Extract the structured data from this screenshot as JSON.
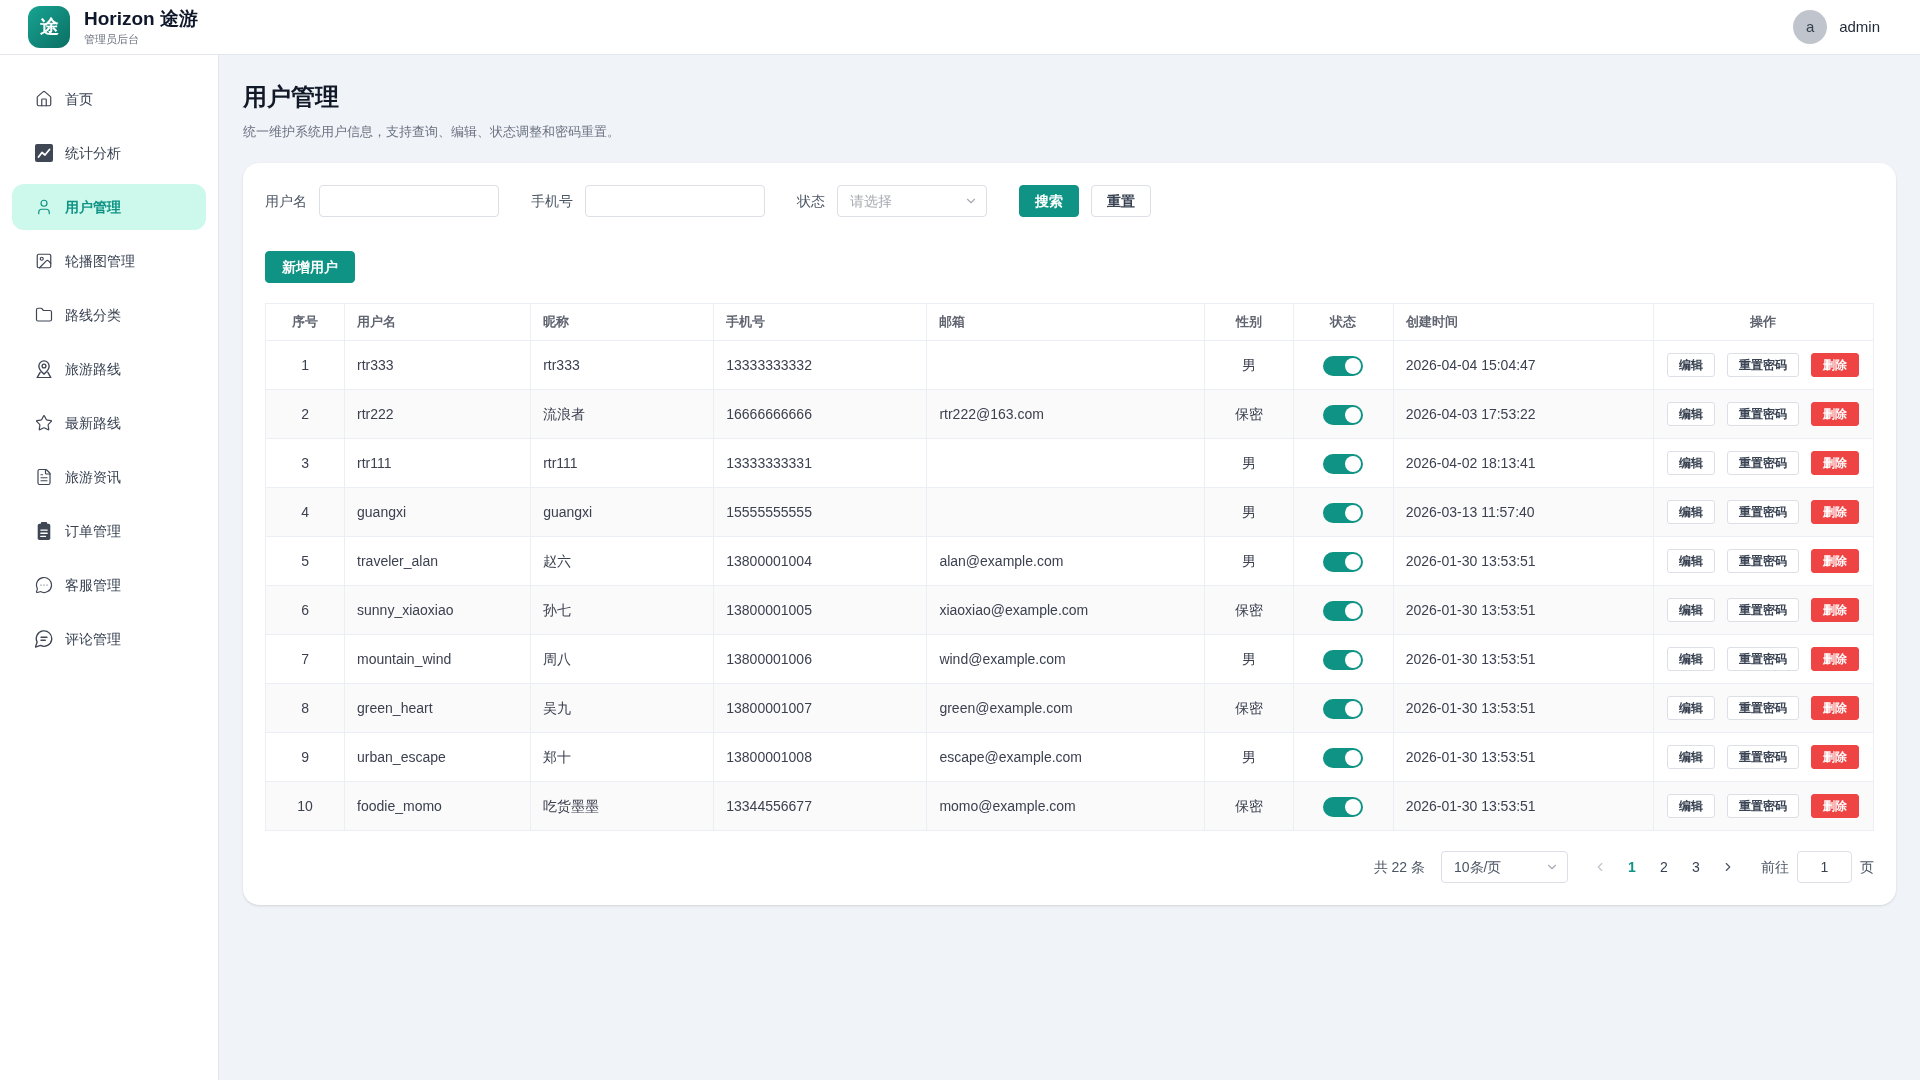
{
  "app": {
    "logo_text": "途",
    "title": "Horizon 途游",
    "subtitle": "管理员后台"
  },
  "user": {
    "avatar_letter": "a",
    "name": "admin"
  },
  "sidebar": {
    "items": [
      {
        "label": "首页",
        "selected": false
      },
      {
        "label": "统计分析",
        "selected": false
      },
      {
        "label": "用户管理",
        "selected": true
      },
      {
        "label": "轮播图管理",
        "selected": false
      },
      {
        "label": "路线分类",
        "selected": false
      },
      {
        "label": "旅游路线",
        "selected": false
      },
      {
        "label": "最新路线",
        "selected": false
      },
      {
        "label": "旅游资讯",
        "selected": false
      },
      {
        "label": "订单管理",
        "selected": false
      },
      {
        "label": "客服管理",
        "selected": false
      },
      {
        "label": "评论管理",
        "selected": false
      }
    ]
  },
  "page": {
    "title": "用户管理",
    "description": "统一维护系统用户信息，支持查询、编辑、状态调整和密码重置。"
  },
  "filters": [
    {
      "label": "用户名",
      "kind": "input"
    },
    {
      "label": "手机号",
      "kind": "input"
    },
    {
      "label": "状态",
      "kind": "select",
      "placeholder": "请选择"
    }
  ],
  "filter_buttons": [
    {
      "label": "搜索",
      "kind": "primary"
    },
    {
      "label": "重置",
      "kind": "default"
    }
  ],
  "add_button": {
    "label": "新增用户",
    "kind": "primary"
  },
  "table": {
    "columns": [
      "序号",
      "用户名",
      "昵称",
      "手机号",
      "邮箱",
      "性别",
      "状态",
      "创建时间",
      "操作"
    ],
    "rows": [
      {
        "index": "1",
        "username": "rtr333",
        "nickname": "rtr333",
        "phone": "13333333332",
        "gender": "男",
        "enabled": true,
        "created_at": "2026-04-04 15:04:47",
        "actions": [
          {
            "label": "编辑",
            "kind": "plain"
          },
          {
            "label": "重置密码",
            "kind": "plain"
          },
          {
            "label": "删除",
            "kind": "danger"
          }
        ]
      },
      {
        "index": "2",
        "username": "rtr222",
        "nickname": "流浪者",
        "phone": "16666666666",
        "email": "rtr222@163.com",
        "gender": "保密",
        "enabled": true,
        "created_at": "2026-04-03 17:53:22",
        "actions": [
          {
            "label": "编辑",
            "kind": "plain"
          },
          {
            "label": "重置密码",
            "kind": "plain"
          },
          {
            "label": "删除",
            "kind": "danger"
          }
        ]
      },
      {
        "index": "3",
        "username": "rtr111",
        "nickname": "rtr111",
        "phone": "13333333331",
        "gender": "男",
        "enabled": true,
        "created_at": "2026-04-02 18:13:41",
        "actions": [
          {
            "label": "编辑",
            "kind": "plain"
          },
          {
            "label": "重置密码",
            "kind": "plain"
          },
          {
            "label": "删除",
            "kind": "danger"
          }
        ]
      },
      {
        "index": "4",
        "username": "guangxi",
        "nickname": "guangxi",
        "phone": "15555555555",
        "gender": "男",
        "enabled": true,
        "created_at": "2026-03-13 11:57:40",
        "actions": [
          {
            "label": "编辑",
            "kind": "plain"
          },
          {
            "label": "重置密码",
            "kind": "plain"
          },
          {
            "label": "删除",
            "kind": "danger"
          }
        ]
      },
      {
        "index": "5",
        "username": "traveler_alan",
        "nickname": "赵六",
        "phone": "13800001004",
        "email": "alan@example.com",
        "gender": "男",
        "enabled": true,
        "created_at": "2026-01-30 13:53:51",
        "actions": [
          {
            "label": "编辑",
            "kind": "plain"
          },
          {
            "label": "重置密码",
            "kind": "plain"
          },
          {
            "label": "删除",
            "kind": "danger"
          }
        ]
      },
      {
        "index": "6",
        "username": "sunny_xiaoxiao",
        "nickname": "孙七",
        "phone": "13800001005",
        "email": "xiaoxiao@example.com",
        "gender": "保密",
        "enabled": true,
        "created_at": "2026-01-30 13:53:51",
        "actions": [
          {
            "label": "编辑",
            "kind": "plain"
          },
          {
            "label": "重置密码",
            "kind": "plain"
          },
          {
            "label": "删除",
            "kind": "danger"
          }
        ]
      },
      {
        "index": "7",
        "username": "mountain_wind",
        "nickname": "周八",
        "phone": "13800001006",
        "email": "wind@example.com",
        "gender": "男",
        "enabled": true,
        "created_at": "2026-01-30 13:53:51",
        "actions": [
          {
            "label": "编辑",
            "kind": "plain"
          },
          {
            "label": "重置密码",
            "kind": "plain"
          },
          {
            "label": "删除",
            "kind": "danger"
          }
        ]
      },
      {
        "index": "8",
        "username": "green_heart",
        "nickname": "吴九",
        "phone": "13800001007",
        "email": "green@example.com",
        "gender": "保密",
        "enabled": true,
        "created_at": "2026-01-30 13:53:51",
        "actions": [
          {
            "label": "编辑",
            "kind": "plain"
          },
          {
            "label": "重置密码",
            "kind": "plain"
          },
          {
            "label": "删除",
            "kind": "danger"
          }
        ]
      },
      {
        "index": "9",
        "username": "urban_escape",
        "nickname": "郑十",
        "phone": "13800001008",
        "email": "escape@example.com",
        "gender": "男",
        "enabled": true,
        "created_at": "2026-01-30 13:53:51",
        "actions": [
          {
            "label": "编辑",
            "kind": "plain"
          },
          {
            "label": "重置密码",
            "kind": "plain"
          },
          {
            "label": "删除",
            "kind": "danger"
          }
        ]
      },
      {
        "index": "10",
        "username": "foodie_momo",
        "nickname": "吃货墨墨",
        "phone": "13344556677",
        "email": "momo@example.com",
        "gender": "保密",
        "enabled": true,
        "created_at": "2026-01-30 13:53:51",
        "actions": [
          {
            "label": "编辑",
            "kind": "plain"
          },
          {
            "label": "重置密码",
            "kind": "plain"
          },
          {
            "label": "删除",
            "kind": "danger"
          }
        ]
      }
    ]
  },
  "pagination": {
    "total": "共 22 条",
    "page_size": "10条/页",
    "prev_disabled": true,
    "next_disabled": false,
    "pages": [
      {
        "label": "1",
        "selected": true
      },
      {
        "label": "2",
        "selected": false
      },
      {
        "label": "3",
        "selected": false
      }
    ],
    "goto_label": "前往",
    "goto_value": "1",
    "goto_suffix": "页"
  }
}
